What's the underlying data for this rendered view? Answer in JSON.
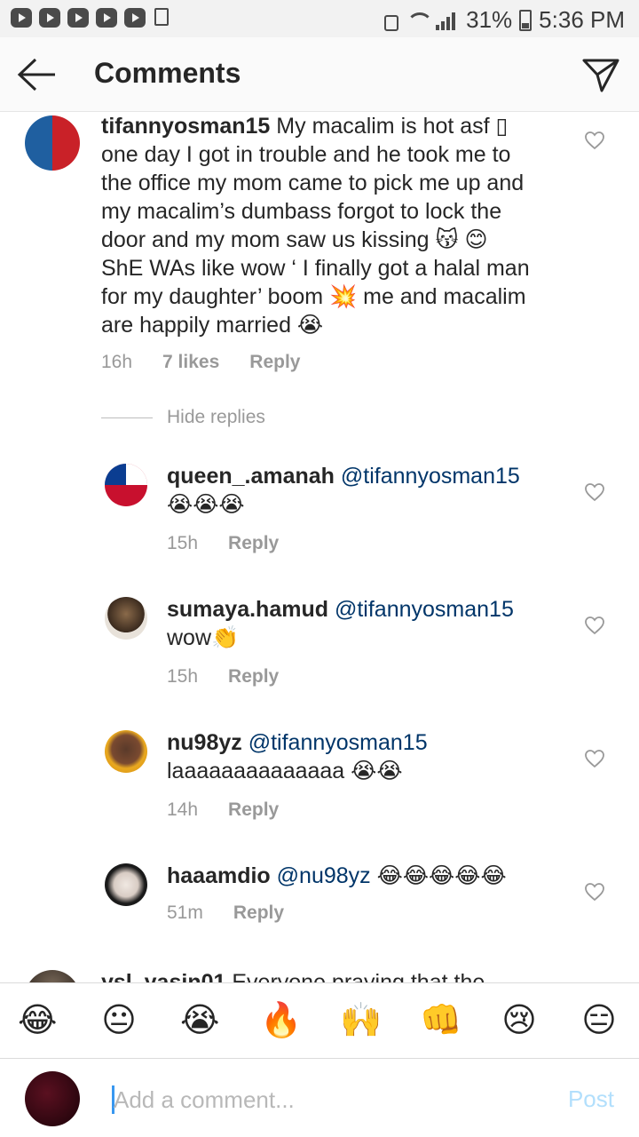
{
  "status_bar": {
    "battery": "31%",
    "time": "5:36 PM"
  },
  "header": {
    "title": "Comments"
  },
  "main_comment": {
    "username": "tifannyosman15",
    "text": "My macalim is hot asf ▯ one day I got in trouble and he took me to the office my mom came to pick me up and my macalim’s dumbass forgot to lock the door and my mom saw us kissing 😽 😊 ShE WAs like wow ‘ I finally got a halal man for my daughter’ boom 💥 me and macalim are happily married 😭",
    "lines": [
      "My macalim is hot asf ▯",
      "one day I got in trouble and he took me to",
      "the office my mom came to pick me up and",
      "my macalim’s dumbass forgot to lock the",
      "door and my mom saw us kissing 😽 😊",
      "ShE WAs like wow ‘ I finally got a halal man",
      "for my daughter’ boom 💥 me and macalim",
      "are happily married 😭"
    ],
    "time": "16h",
    "likes": "7 likes",
    "reply": "Reply"
  },
  "hide_replies": "Hide replies",
  "replies": [
    {
      "username": "queen_.amanah",
      "mention": "@tifannyosman15",
      "text": "😭😭😭",
      "time": "15h",
      "reply": "Reply"
    },
    {
      "username": "sumaya.hamud",
      "mention": "@tifannyosman15",
      "text": "wow👏",
      "time": "15h",
      "reply": "Reply"
    },
    {
      "username": "nu98yz",
      "mention": "@tifannyosman15",
      "text": "laaaaaaaaaaaaaa 😭😭",
      "time": "14h",
      "reply": "Reply"
    },
    {
      "username": "haaamdio",
      "mention": "@nu98yz",
      "text": "😂😂😂😂😂",
      "time": "51m",
      "reply": "Reply"
    }
  ],
  "next_comment": {
    "username": "ysl_yasin01",
    "text": "Everyone praying that the"
  },
  "emoji_bar": [
    "😂",
    "😐",
    "😭",
    "🔥",
    "🙌",
    "👊",
    "😢",
    "😑"
  ],
  "input": {
    "placeholder": "Add a comment...",
    "post_label": "Post"
  },
  "colors": {
    "mention": "#003569",
    "meta": "#999999",
    "post_disabled": "#b2dffc",
    "caret": "#3897f0"
  }
}
